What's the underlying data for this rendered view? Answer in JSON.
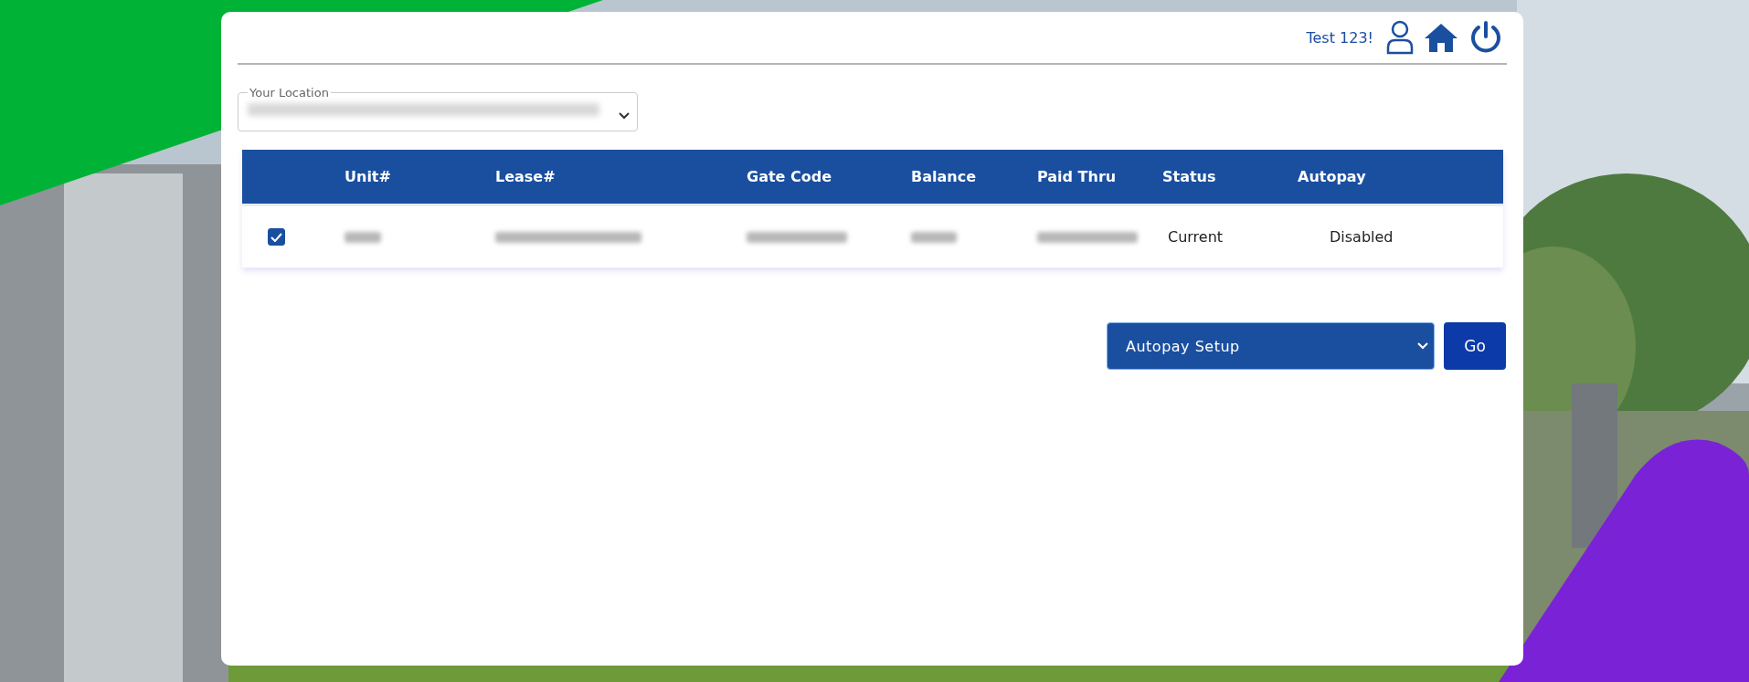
{
  "header": {
    "greeting": "Test 123!"
  },
  "location": {
    "label": "Your Location"
  },
  "table": {
    "columns": [
      "Unit#",
      "Lease#",
      "Gate Code",
      "Balance",
      "Paid Thru",
      "Status",
      "Autopay"
    ],
    "rows": [
      {
        "selected": true,
        "status": "Current",
        "autopay": "Disabled"
      }
    ]
  },
  "actions": {
    "select_value": "Autopay Setup",
    "button": "Go"
  }
}
